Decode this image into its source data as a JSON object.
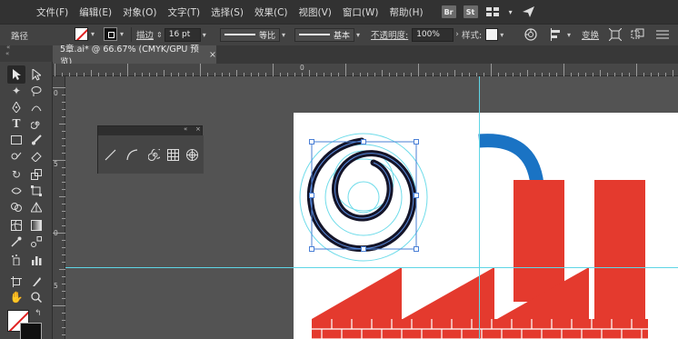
{
  "menu": {
    "items": [
      "文件(F)",
      "编辑(E)",
      "对象(O)",
      "文字(T)",
      "选择(S)",
      "效果(C)",
      "视图(V)",
      "窗口(W)",
      "帮助(H)"
    ],
    "badges": [
      "Br",
      "St"
    ]
  },
  "control_bar": {
    "selection_label": "路径",
    "stroke_label": "描边",
    "stroke_weight": "16 pt",
    "profile_label": "等比",
    "brush_label": "基本",
    "opacity_label": "不透明度:",
    "opacity_value": "100%",
    "style_label": "样式:",
    "transform_label": "变换"
  },
  "document_tab": {
    "title": "5章.ai* @ 66.67% (CMYK/GPU 预览)",
    "close": "×"
  },
  "rulers": {
    "top": [
      "0"
    ],
    "left": [
      "0",
      "5",
      "0",
      "5"
    ]
  },
  "colors": {
    "accent_red": "#e43a2e",
    "accent_blue": "#1a73c4",
    "guide": "#5fd6e6",
    "selection": "#4a7fd6"
  }
}
